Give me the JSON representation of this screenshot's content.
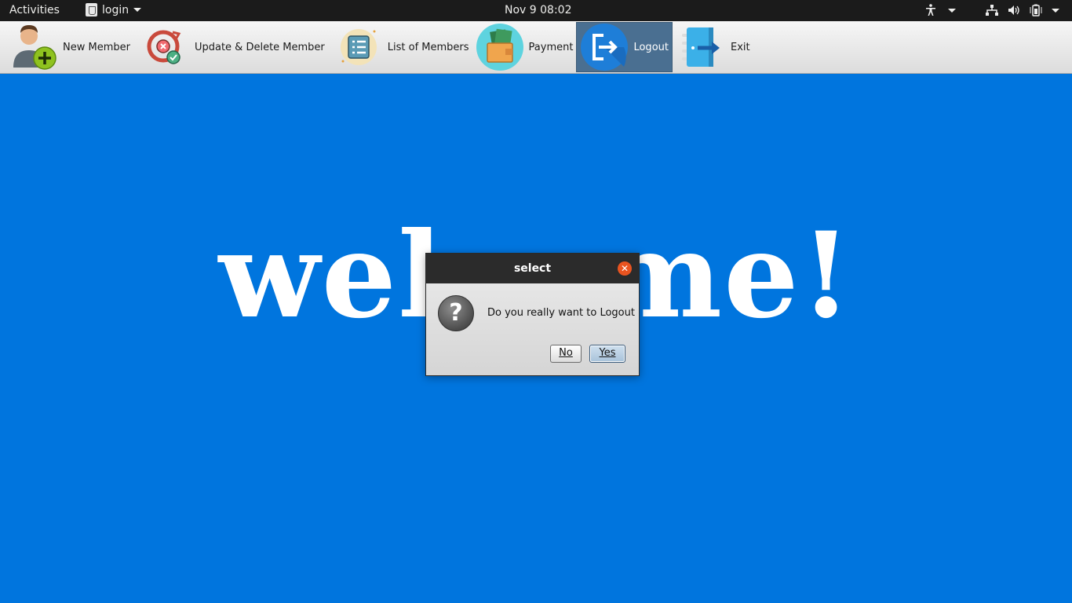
{
  "topbar": {
    "activities": "Activities",
    "app_menu": "login",
    "clock": "Nov 9  08:02"
  },
  "toolbar": {
    "items": [
      {
        "label": "New Member",
        "icon": "add-user-icon"
      },
      {
        "label": "Update & Delete Member",
        "icon": "update-delete-icon"
      },
      {
        "label": "List of Members",
        "icon": "list-icon"
      },
      {
        "label": "Payment",
        "icon": "wallet-icon"
      },
      {
        "label": "Logout",
        "icon": "logout-icon",
        "active": true
      },
      {
        "label": "Exit",
        "icon": "exit-icon"
      }
    ]
  },
  "main": {
    "welcome_text": "welcome!"
  },
  "dialog": {
    "title": "select",
    "message": "Do you really want to Logout",
    "no_label": "No",
    "yes_label": "Yes"
  },
  "colors": {
    "background": "#0075de",
    "topbar": "#1b1b1b",
    "active_tool": "#4a6f91",
    "close_button": "#e95420"
  }
}
